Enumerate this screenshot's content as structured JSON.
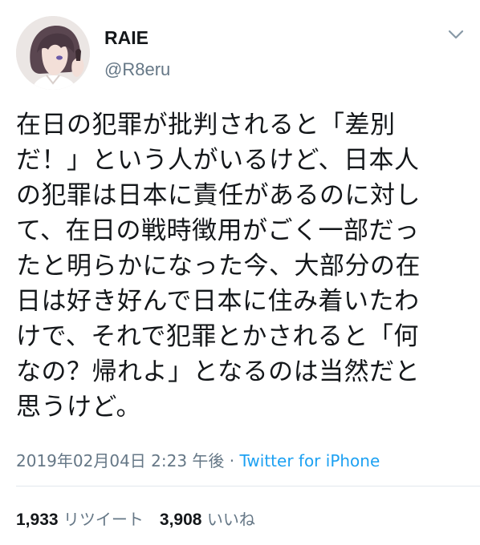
{
  "user": {
    "display_name": "RAIE",
    "handle": "@R8eru"
  },
  "tweet": {
    "lines": [
      "在日の犯罪が批判されると「差別",
      "だ！」という人がいるけど、日本人",
      "の犯罪は日本に責任があるのに対し",
      "て、在日の戦時徴用がごく一部だっ",
      "たと明らかになった今、大部分の在",
      "日は好き好んで日本に住み着いたわ",
      "けで、それで犯罪とかされると「何",
      "なの？帰れよ」となるのは当然だと",
      "思うけど。"
    ],
    "timestamp": "2019年02月04日 2:23 午後",
    "separator": "·",
    "source": "Twitter for iPhone"
  },
  "stats": {
    "retweet_count": "1,933",
    "retweet_label": "リツイート",
    "like_count": "3,908",
    "like_label": "いいね"
  },
  "icons": {
    "menu": "chevron-down-icon",
    "avatar": "avatar-illustration"
  },
  "colors": {
    "text": "#14171a",
    "muted": "#657786",
    "link": "#1da1f2",
    "divider": "#e1e8ed"
  }
}
